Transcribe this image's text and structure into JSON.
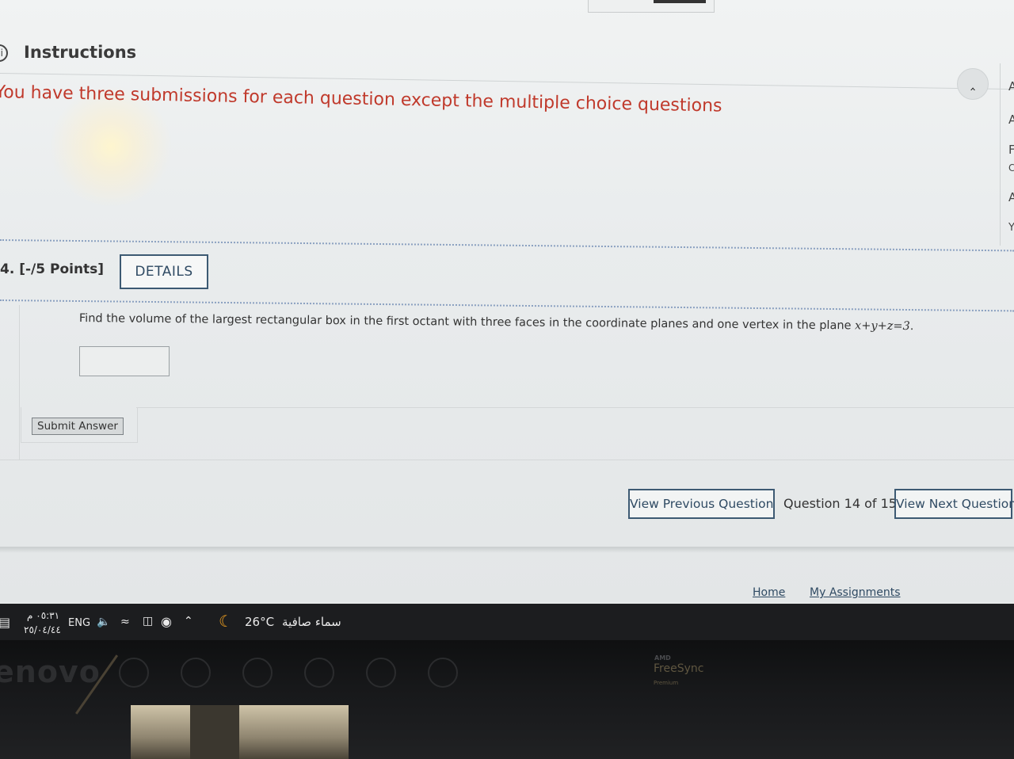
{
  "instructions": {
    "title": "Instructions",
    "message": "You have three submissions for each question except the multiple choice questions"
  },
  "right_sidebar_fragments": [
    "A",
    "A",
    "F",
    "C",
    "A",
    "Y"
  ],
  "question": {
    "number_points": "4.  [-/5 Points]",
    "details_label": "DETAILS",
    "text_prefix": "Find the volume of the largest rectangular box in the first octant with three faces in the coordinate planes and one vertex in the plane ",
    "equation": "x+y+z=3",
    "text_suffix": ".",
    "answer_value": "",
    "submit_label": "Submit Answer"
  },
  "navigation": {
    "previous_label": "View Previous Question",
    "counter": "Question 14 of 15",
    "next_label": "View Next Question"
  },
  "footer": {
    "home": "Home",
    "assignments": "My Assignments"
  },
  "taskbar": {
    "time": "٠٥:٣١ م",
    "date": "٢٥/٠٤/٤٤",
    "language": "ENG",
    "temperature": "26°C",
    "weather": "سماء صافية"
  },
  "monitor": {
    "brand": "enovo",
    "amd": "AMD",
    "freesync": "FreeSync",
    "freesync_sub": "Premium"
  },
  "colors": {
    "instruction_text": "#c0392b",
    "button_border": "#3d5a73",
    "taskbar": "#1c1d1f"
  }
}
